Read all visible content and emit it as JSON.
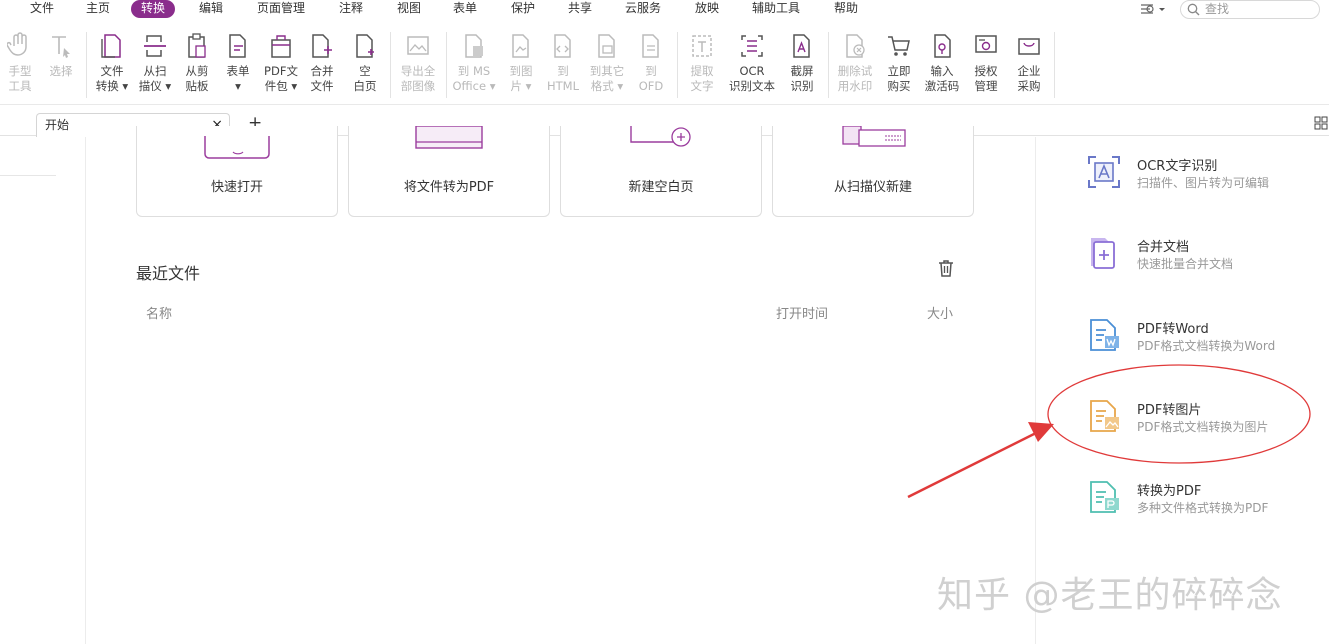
{
  "menubar": {
    "items": [
      "文件",
      "主页",
      "转换",
      "编辑",
      "页面管理",
      "注释",
      "视图",
      "表单",
      "保护",
      "共享",
      "云服务",
      "放映",
      "辅助工具",
      "帮助"
    ],
    "active_index": 2,
    "search_placeholder": "查找"
  },
  "toolbar": {
    "tools": [
      {
        "label": "手型\n工具",
        "icon": "hand-icon",
        "disabled": true
      },
      {
        "label": "选择",
        "icon": "select-text-icon",
        "disabled": true
      },
      {
        "label": "文件\n转换 ▾",
        "icon": "file-convert-icon",
        "disabled": false
      },
      {
        "label": "从扫\n描仪 ▾",
        "icon": "scanner-icon",
        "disabled": false
      },
      {
        "label": "从剪\n贴板",
        "icon": "clipboard-icon",
        "disabled": false
      },
      {
        "label": "表单\n▾",
        "icon": "form-icon",
        "disabled": false
      },
      {
        "label": "PDF文\n件包 ▾",
        "icon": "pdf-package-icon",
        "disabled": false
      },
      {
        "label": "合并\n文件",
        "icon": "merge-files-icon",
        "disabled": false
      },
      {
        "label": "空\n白页",
        "icon": "blank-page-icon",
        "disabled": false
      },
      {
        "label": "导出全\n部图像",
        "icon": "export-images-icon",
        "disabled": true
      },
      {
        "label": "到 MS\nOffice ▾",
        "icon": "to-office-icon",
        "disabled": true
      },
      {
        "label": "到图\n片 ▾",
        "icon": "to-image-icon",
        "disabled": true
      },
      {
        "label": "到\nHTML",
        "icon": "to-html-icon",
        "disabled": true
      },
      {
        "label": "到其它\n格式 ▾",
        "icon": "to-other-format-icon",
        "disabled": true
      },
      {
        "label": "到\nOFD",
        "icon": "to-ofd-icon",
        "disabled": true
      },
      {
        "label": "提取\n文字",
        "icon": "extract-text-icon",
        "disabled": true
      },
      {
        "label": "OCR\n识别文本",
        "icon": "ocr-icon",
        "disabled": false
      },
      {
        "label": "截屏\n识别",
        "icon": "screenshot-ocr-icon",
        "disabled": false
      },
      {
        "label": "删除试\n用水印",
        "icon": "remove-watermark-icon",
        "disabled": true
      },
      {
        "label": "立即\n购买",
        "icon": "cart-icon",
        "disabled": false
      },
      {
        "label": "输入\n激活码",
        "icon": "activation-code-icon",
        "disabled": false
      },
      {
        "label": "授权\n管理",
        "icon": "license-icon",
        "disabled": false
      },
      {
        "label": "企业\n采购",
        "icon": "enterprise-purchase-icon",
        "disabled": false
      }
    ]
  },
  "tabs": {
    "start_label": "开始",
    "close_glyph": "×",
    "add_glyph": "+"
  },
  "quick_actions": [
    {
      "label": "快速打开",
      "icon": "quick-open-icon"
    },
    {
      "label": "将文件转为PDF",
      "icon": "convert-to-pdf-icon"
    },
    {
      "label": "新建空白页",
      "icon": "new-blank-page-icon"
    },
    {
      "label": "从扫描仪新建",
      "icon": "new-from-scanner-icon"
    }
  ],
  "recent": {
    "title": "最近文件",
    "columns": {
      "name": "名称",
      "open_time": "打开时间",
      "size": "大小"
    }
  },
  "features": [
    {
      "title": "OCR文字识别",
      "desc": "扫描件、图片转为可编辑",
      "icon": "ocr-feature-icon",
      "color": "#6a78c8"
    },
    {
      "title": "合并文档",
      "desc": "快速批量合并文档",
      "icon": "merge-feature-icon",
      "color": "#8a6fd6"
    },
    {
      "title": "PDF转Word",
      "desc": "PDF格式文档转换为Word",
      "icon": "pdf-to-word-icon",
      "color": "#4a8fd6"
    },
    {
      "title": "PDF转图片",
      "desc": "PDF格式文档转换为图片",
      "icon": "pdf-to-image-icon",
      "color": "#e8a64a"
    },
    {
      "title": "转换为PDF",
      "desc": "多种文件格式转换为PDF",
      "icon": "convert-pdf-feature-icon",
      "color": "#4fbfb0"
    }
  ],
  "watermark": "知乎 @老王的碎碎念",
  "annotation_color": "#e03a3a",
  "accent_color": "#8a2d8c"
}
